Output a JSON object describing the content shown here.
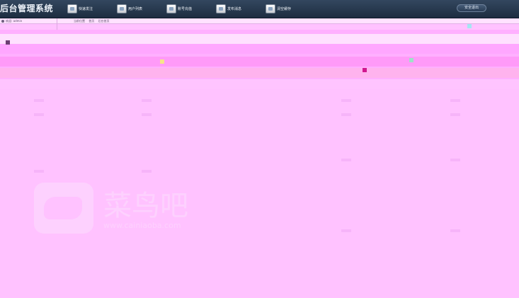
{
  "header": {
    "app_title": "后台管理系统",
    "nav": [
      {
        "label": "快速发注",
        "icon": "doc-icon"
      },
      {
        "label": "用户列表",
        "icon": "users-icon"
      },
      {
        "label": "账号充值",
        "icon": "wallet-icon"
      },
      {
        "label": "发布消息",
        "icon": "message-icon"
      },
      {
        "label": "清空缓存",
        "icon": "trash-icon"
      }
    ],
    "logout_label": "安全退出"
  },
  "subbar": {
    "user_label": "欢迎: admin",
    "breadcrumb": [
      "当前位置",
      "首页",
      "后台首页"
    ]
  },
  "watermark": {
    "text": "菜鸟吧",
    "sub": "www.cainiaoba.com"
  },
  "colors": {
    "header_bg": "#1d2d40",
    "page_bg": "#ffc2ff"
  }
}
